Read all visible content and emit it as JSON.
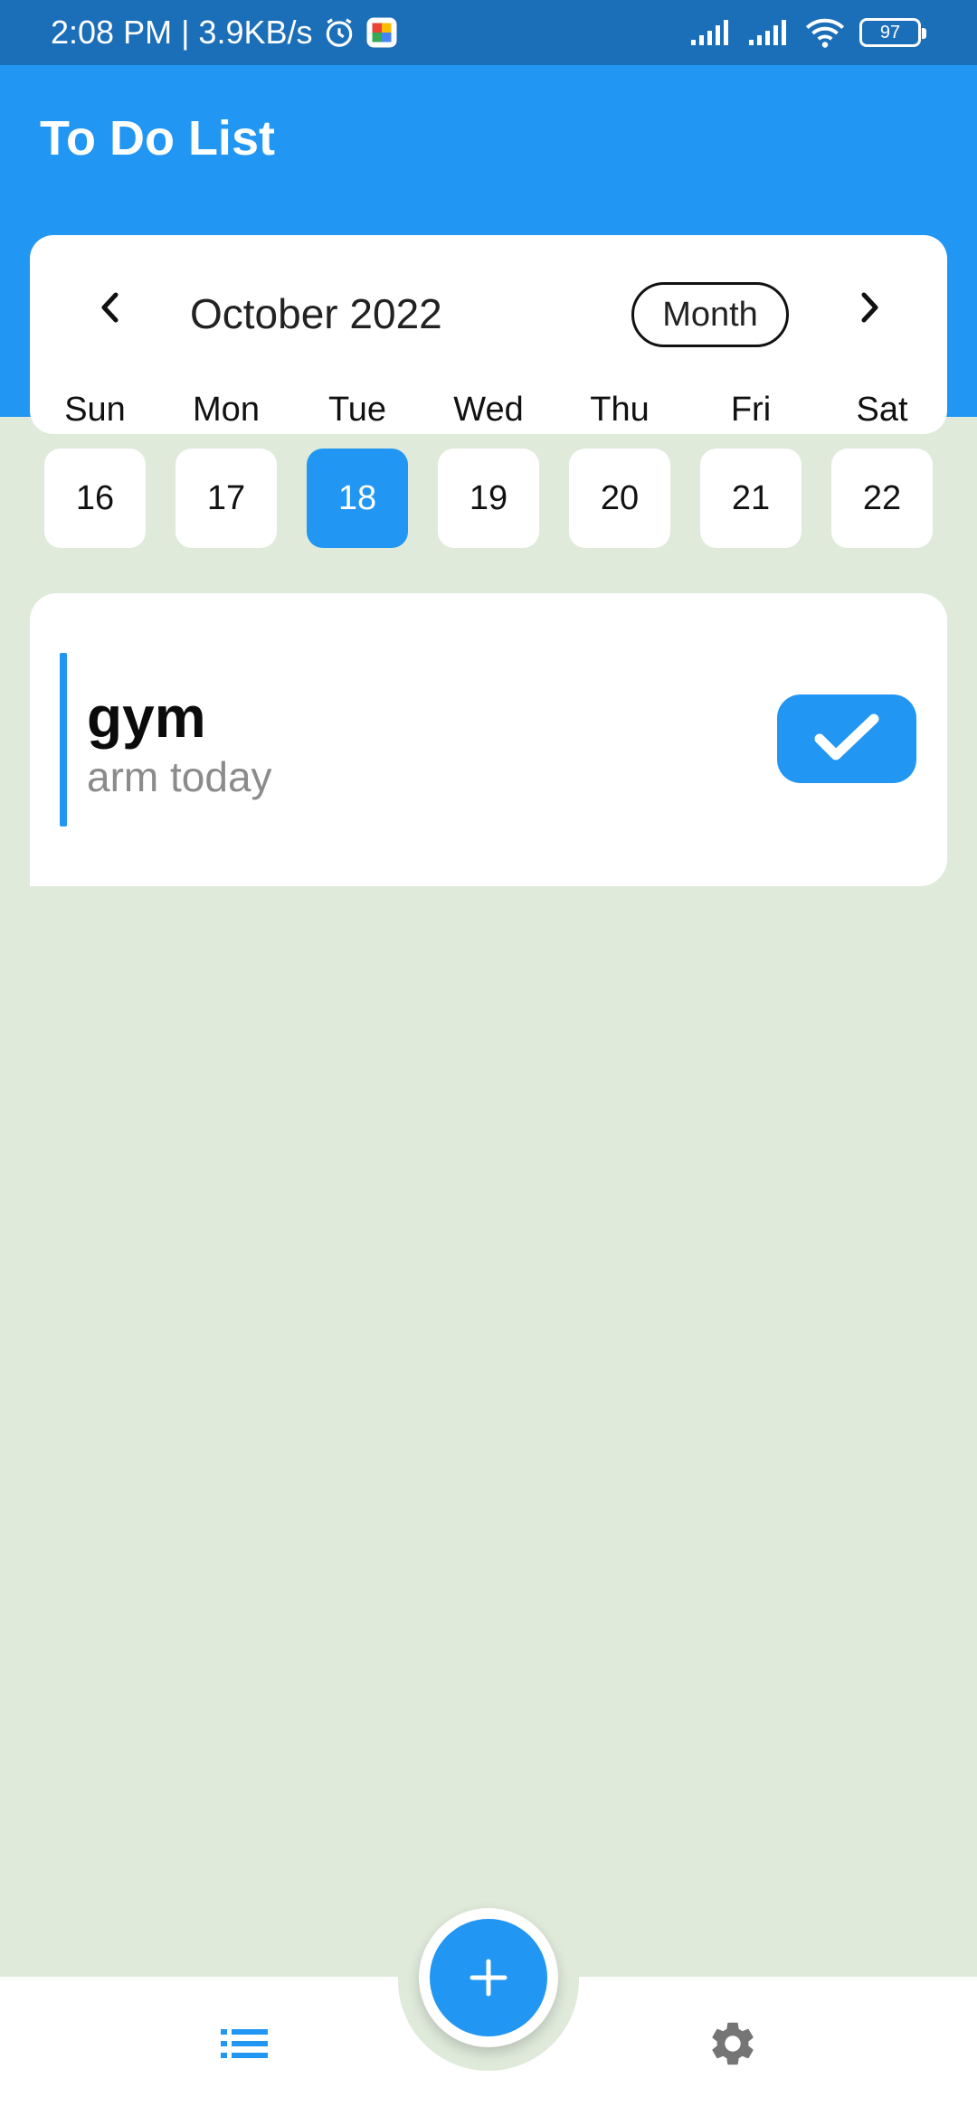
{
  "status_bar": {
    "time_speed": "2:08 PM | 3.9KB/s",
    "battery": "97",
    "icons": [
      "alarm-icon",
      "app-notification-icon",
      "signal-icon",
      "signal-icon",
      "wifi-icon",
      "battery-icon"
    ]
  },
  "app_bar": {
    "title": "To Do List"
  },
  "calendar": {
    "month_label": "October 2022",
    "view_toggle": "Month",
    "weekdays": [
      "Sun",
      "Mon",
      "Tue",
      "Wed",
      "Thu",
      "Fri",
      "Sat"
    ],
    "days": [
      "16",
      "17",
      "18",
      "19",
      "20",
      "21",
      "22"
    ],
    "selected_day": "18"
  },
  "tasks": [
    {
      "title": "gym",
      "subtitle": "arm today",
      "completed": true
    }
  ],
  "bottom_nav": {
    "items": [
      "list-icon",
      "add-icon",
      "settings-icon"
    ]
  },
  "colors": {
    "primary": "#2196f3",
    "status_bar": "#1b6eb8",
    "background": "#dfeadb",
    "card": "#ffffff",
    "subtitle": "#8b8b8b",
    "icon_gray": "#757575"
  }
}
